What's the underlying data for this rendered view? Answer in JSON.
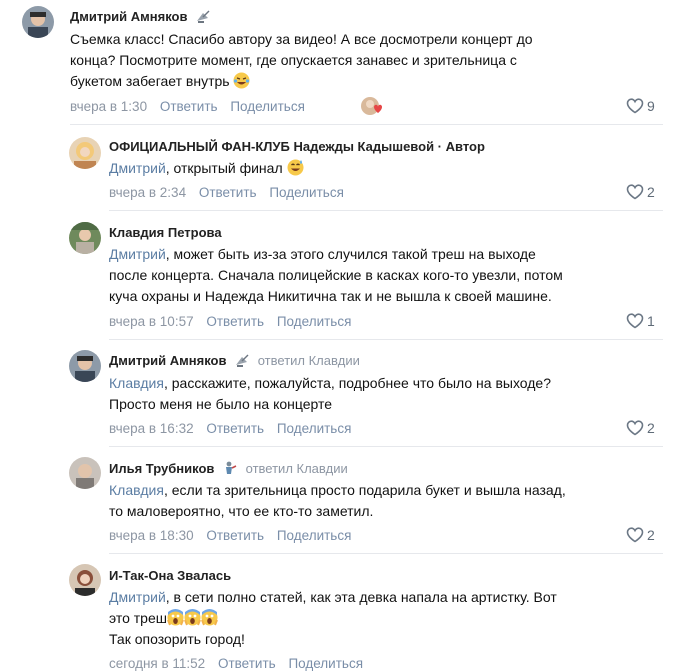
{
  "comments": [
    {
      "author": "Дмитрий Амняков",
      "badge_icon": "satellite-dish-icon",
      "lines": [
        "Съемка класс! Спасибо автору за видео! А все досмотрели концерт до",
        "конца? Посмотрите момент, где опускается занавес и зрительница с",
        "букетом забегает внутрь"
      ],
      "time": "вчера в 1:30",
      "reply_label": "Ответить",
      "share_label": "Поделиться",
      "likes": "9"
    },
    {
      "author": "ОФИЦИАЛЬНЫЙ ФАН-КЛУБ Надежды Кадышевой · Автор",
      "addressee": "Дмитрий",
      "text": ", открытый финал",
      "time": "вчера в 2:34",
      "reply_label": "Ответить",
      "share_label": "Поделиться",
      "likes": "2"
    },
    {
      "author": "Клавдия Петрова",
      "addressee": "Дмитрий",
      "lines": [
        ", может быть из-за этого случился такой треш на выходе",
        "после концерта. Сначала полицейские в касках кого-то увезли, потом",
        "куча охраны и Надежда Никитична так и не вышла к своей машине."
      ],
      "time": "вчера в 10:57",
      "reply_label": "Ответить",
      "share_label": "Поделиться",
      "likes": "1"
    },
    {
      "author": "Дмитрий Амняков",
      "badge_icon": "satellite-dish-icon",
      "replied_to": "ответил Клавдии",
      "addressee": "Клавдия",
      "lines": [
        ", расскажите, пожалуйста, подробнее что было на выходе?",
        "Просто меня не было на концерте"
      ],
      "time": "вчера в 16:32",
      "reply_label": "Ответить",
      "share_label": "Поделиться",
      "likes": "2"
    },
    {
      "author": "Илья Трубников",
      "badge_icon": "person-figure-icon",
      "replied_to": "ответил Клавдии",
      "addressee": "Клавдия",
      "lines": [
        ", если та зрительница просто подарила букет и вышла назад,",
        "то маловероятно, что ее кто-то заметил."
      ],
      "time": "вчера в 18:30",
      "reply_label": "Ответить",
      "share_label": "Поделиться",
      "likes": "2"
    },
    {
      "author": "И-Так-Она Звалась",
      "addressee": "Дмитрий",
      "lines": [
        ", в сети полно статей, как эта девка напала на артистку. Вот",
        "это треш",
        "Так опозорить город!"
      ],
      "time": "сегодня в 11:52",
      "reply_label": "Ответить",
      "share_label": "Поделиться"
    }
  ],
  "colors": {
    "link": "#5b7da3",
    "meta": "#8d96a3",
    "divider": "#e6e8ec"
  }
}
